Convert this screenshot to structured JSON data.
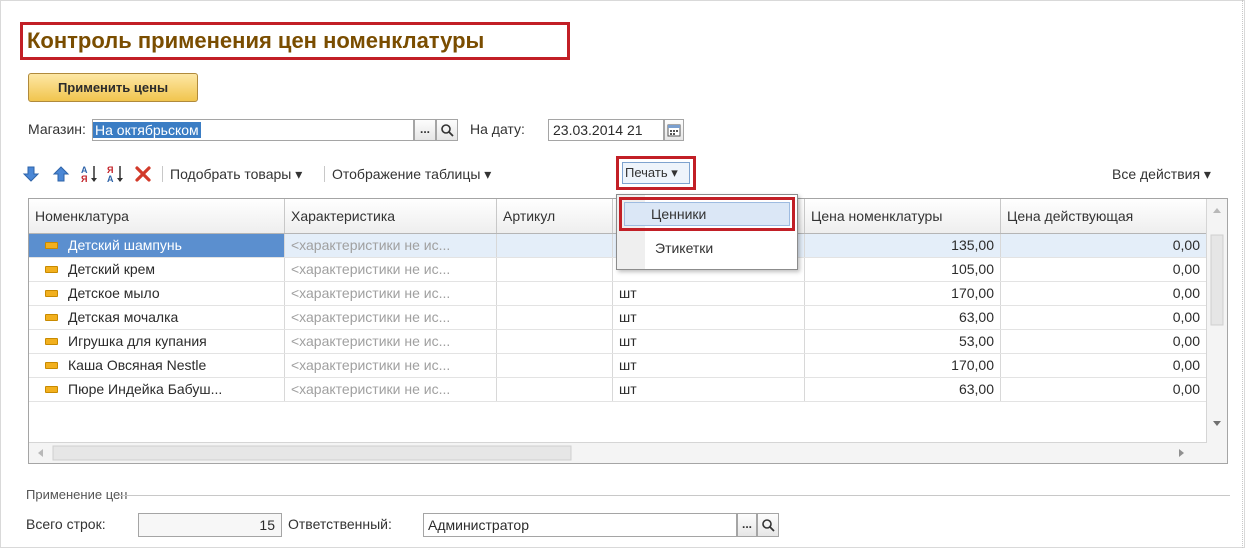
{
  "title": "Контроль применения цен номенклатуры",
  "apply_button": "Применить цены",
  "store": {
    "label": "Магазин:",
    "value": "На октябрьском",
    "ellipsis": "..."
  },
  "date": {
    "label": "На дату:",
    "value": "23.03.2014 21"
  },
  "toolbar": {
    "pick_goods": "Подобрать товары ▾",
    "table_view": "Отображение таблицы ▾",
    "print": "Печать ▾",
    "all_actions": "Все действия ▾"
  },
  "columns": [
    "Номенклатура",
    "Характеристика",
    "Артикул",
    "",
    "Цена номенклатуры",
    "Цена действующая"
  ],
  "rows": [
    {
      "name": "Детский шампунь",
      "char": "<характеристики не ис...",
      "article": "",
      "unit": "",
      "price": "135,00",
      "current": "0,00"
    },
    {
      "name": "Детский крем",
      "char": "<характеристики не ис...",
      "article": "",
      "unit": "",
      "price": "105,00",
      "current": "0,00"
    },
    {
      "name": "Детское мыло",
      "char": "<характеристики не ис...",
      "article": "",
      "unit": "шт",
      "price": "170,00",
      "current": "0,00"
    },
    {
      "name": "Детская мочалка",
      "char": "<характеристики не ис...",
      "article": "",
      "unit": "шт",
      "price": "63,00",
      "current": "0,00"
    },
    {
      "name": "Игрушка для купания",
      "char": "<характеристики не ис...",
      "article": "",
      "unit": "шт",
      "price": "53,00",
      "current": "0,00"
    },
    {
      "name": "Каша Овсяная Nestle",
      "char": "<характеристики не ис...",
      "article": "",
      "unit": "шт",
      "price": "170,00",
      "current": "0,00"
    },
    {
      "name": "Пюре Индейка Бабуш...",
      "char": "<характеристики не ис...",
      "article": "",
      "unit": "шт",
      "price": "63,00",
      "current": "0,00"
    }
  ],
  "print_menu": [
    "Ценники",
    "Этикетки"
  ],
  "footer": {
    "section": "Применение цен",
    "total_label": "Всего строк:",
    "total_value": "15",
    "responsible_label": "Ответственный:",
    "responsible_value": "Администратор"
  },
  "colors": {
    "title": "#7a4d00",
    "highlight": "#c21f26",
    "selection": "#3b7dc4",
    "button": "#f1c54e"
  }
}
